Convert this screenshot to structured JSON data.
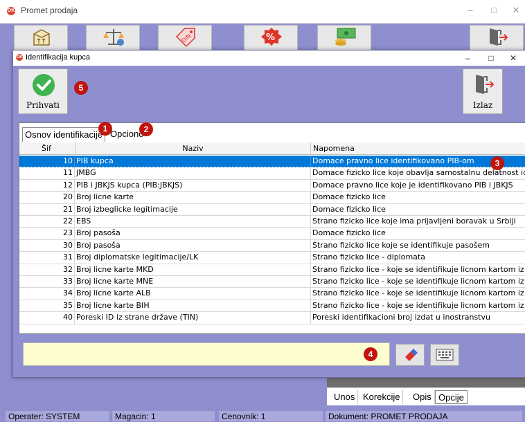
{
  "app": {
    "title": "Promet prodaja",
    "icon_text": "OK"
  },
  "toolbar": {
    "icons": [
      "box-arrows-icon",
      "scales-icon",
      "price-tag-icon",
      "percent-icon",
      "money-icon",
      "exit-door-icon"
    ]
  },
  "dialog": {
    "title": "Identifikacija kupca",
    "accept_label": "Prihvati",
    "exit_label": "Izlaz",
    "tabs": [
      "Osnov identifikacije",
      "Opciono"
    ],
    "columns": {
      "sif": "Šif",
      "naziv": "Naziv",
      "napomena": "Napomena"
    },
    "rows": [
      {
        "sif": "10",
        "naziv": "PIB kupca",
        "napomena": "Domace pravno lice identifikovano PIB-om"
      },
      {
        "sif": "11",
        "naziv": "JMBG",
        "napomena": "Domace fizicko lice koje obavlja samostalnu delatnost identifikovano JMBG-om"
      },
      {
        "sif": "12",
        "naziv": "PIB i JBKJS kupca (PIB:JBKJS)",
        "napomena": "Domace pravno lice koje je identifikovano PIB i JBKJS"
      },
      {
        "sif": "20",
        "naziv": "Broj licne karte",
        "napomena": "Domace fizicko lice"
      },
      {
        "sif": "21",
        "naziv": "Broj izbeglicke legitimacije",
        "napomena": "Domace fizicko lice"
      },
      {
        "sif": "22",
        "naziv": "EBS",
        "napomena": "Strano fizicko lice koje ima prijavljeni boravak u Srbiji"
      },
      {
        "sif": "23",
        "naziv": "Broj pasoša",
        "napomena": "Domace fizicko lice"
      },
      {
        "sif": "30",
        "naziv": "Broj pasoša",
        "napomena": "Strano fizicko lice koje se identifikuje pasošem"
      },
      {
        "sif": "31",
        "naziv": "Broj diplomatske legitimacije/LK",
        "napomena": "Strano fizicko lice - diplomata"
      },
      {
        "sif": "32",
        "naziv": "Broj licne karte MKD",
        "napomena": "Strano fizicko lice - koje se identifikuje licnom kartom iz Makedonije"
      },
      {
        "sif": "33",
        "naziv": "Broj licne karte MNE",
        "napomena": "Strano fizicko lice - koje se identifikuje licnom kartom iz Crne Gore"
      },
      {
        "sif": "34",
        "naziv": "Broj licne karte ALB",
        "napomena": "Strano fizicko lice - koje se identifikuje licnom kartom iz Albanije"
      },
      {
        "sif": "35",
        "naziv": "Broj licne karte BIH",
        "napomena": "Strano fizicko lice - koje se identifikuje licnom kartom iz BiH"
      },
      {
        "sif": "40",
        "naziv": "Poreski ID iz strane države (TIN)",
        "napomena": "Poreski identifikacioni broj izdat u inostranstvu"
      }
    ],
    "selected_row": 0,
    "search_value": "",
    "markers": [
      "1",
      "2",
      "3",
      "4",
      "5"
    ]
  },
  "bottom_tabs": [
    "Unos",
    "Korekcije",
    "Opis",
    "Opcije"
  ],
  "status": {
    "operater": "Operater: SYSTEM",
    "magacin": "Magacin: 1",
    "cenovnik": "Cenovnik: 1",
    "dokument": "Dokument: PROMET PRODAJA"
  },
  "colors": {
    "background": "#8f8fcf",
    "selection": "#0078d7",
    "marker": "#c0140c",
    "search_bg": "#fdfdd0"
  }
}
